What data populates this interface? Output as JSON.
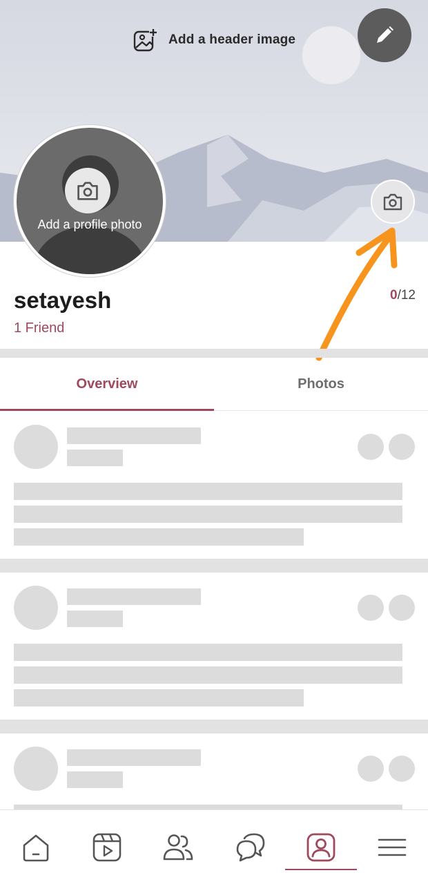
{
  "header": {
    "add_header_label": "Add a header image",
    "add_header_icon": "image-add-icon",
    "edit_icon": "pencil-icon",
    "camera_icon": "camera-icon"
  },
  "profile": {
    "photo_label": "Add a profile photo",
    "photo_icon": "camera-icon",
    "name": "setayesh",
    "friends": "1 Friend",
    "counter_current": "0",
    "counter_total": "/12"
  },
  "tabs": [
    {
      "label": "Overview",
      "active": true
    },
    {
      "label": "Photos",
      "active": false
    }
  ],
  "bottom_nav": [
    {
      "icon": "home-icon",
      "active": false
    },
    {
      "icon": "video-icon",
      "active": false
    },
    {
      "icon": "friends-icon",
      "active": false
    },
    {
      "icon": "chat-icon",
      "active": false
    },
    {
      "icon": "profile-icon",
      "active": true
    },
    {
      "icon": "menu-icon",
      "active": false
    }
  ],
  "colors": {
    "accent": "#a0495d",
    "annotation_arrow": "#f7941d",
    "skeleton": "#dcdcdc",
    "header_bg": "#dcdee6"
  }
}
